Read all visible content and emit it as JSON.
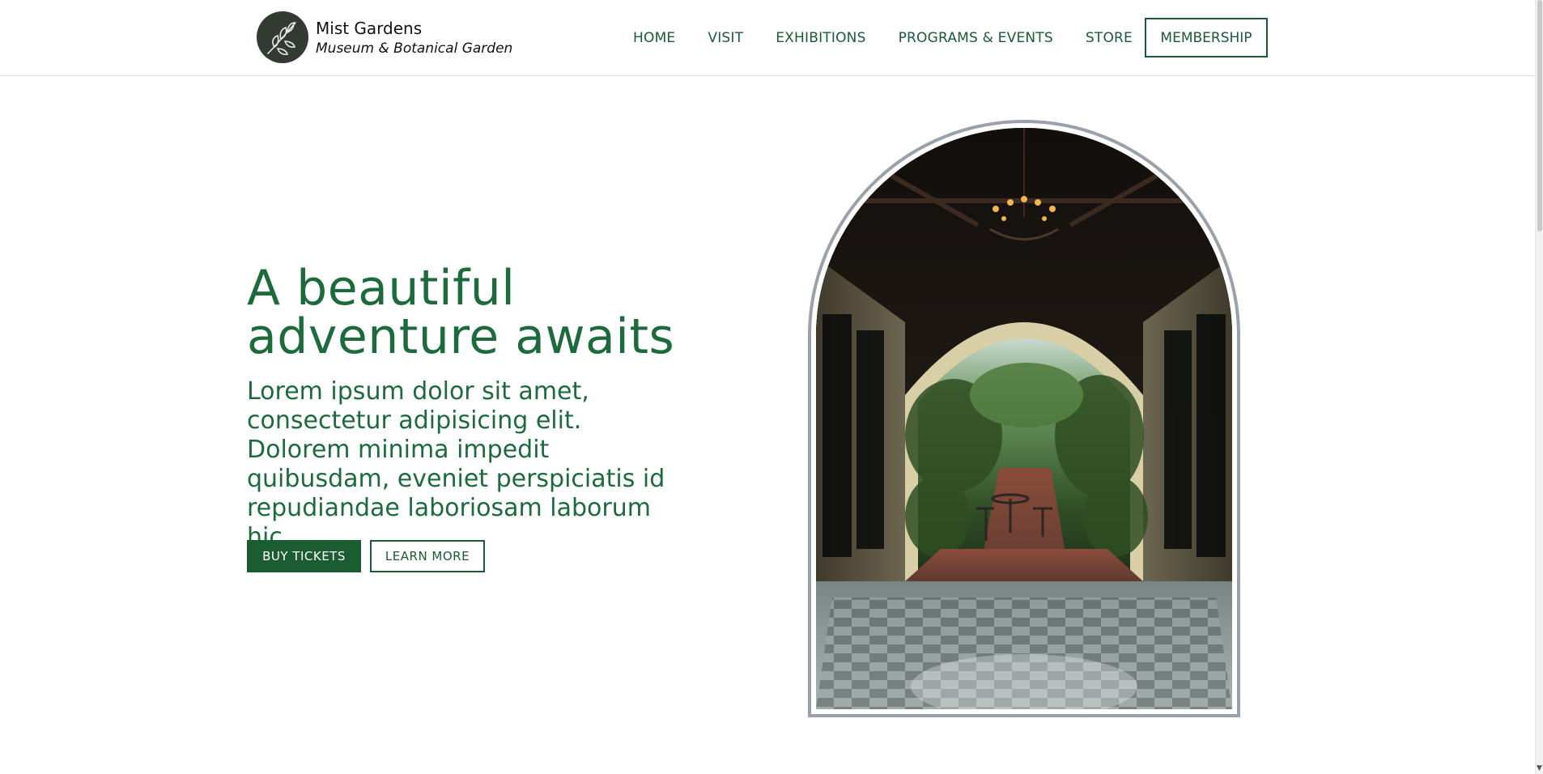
{
  "brand": {
    "name": "Mist Gardens",
    "subtitle": "Museum & Botanical Garden",
    "logo_icon": "leaf-branch-icon"
  },
  "nav": {
    "items": [
      {
        "label": "HOME"
      },
      {
        "label": "VISIT"
      },
      {
        "label": "EXHIBITIONS"
      },
      {
        "label": "PROGRAMS & EVENTS"
      },
      {
        "label": "STORE"
      }
    ],
    "membership_label": "MEMBERSHIP"
  },
  "hero": {
    "title": "A beautiful adventure awaits",
    "text": "Lorem ipsum dolor sit amet, consectetur adipisicing elit. Dolorem minima impedit quibusdam, eveniet perspiciatis id repudiandae laboriosam laborum hic.",
    "primary_button": "BUY TICKETS",
    "secondary_button": "LEARN MORE"
  },
  "colors": {
    "brand_green": "#1b5c32",
    "text_green": "#1d6b3c",
    "logo_dark": "#323a32",
    "frame_grey": "#9aa1ab"
  }
}
